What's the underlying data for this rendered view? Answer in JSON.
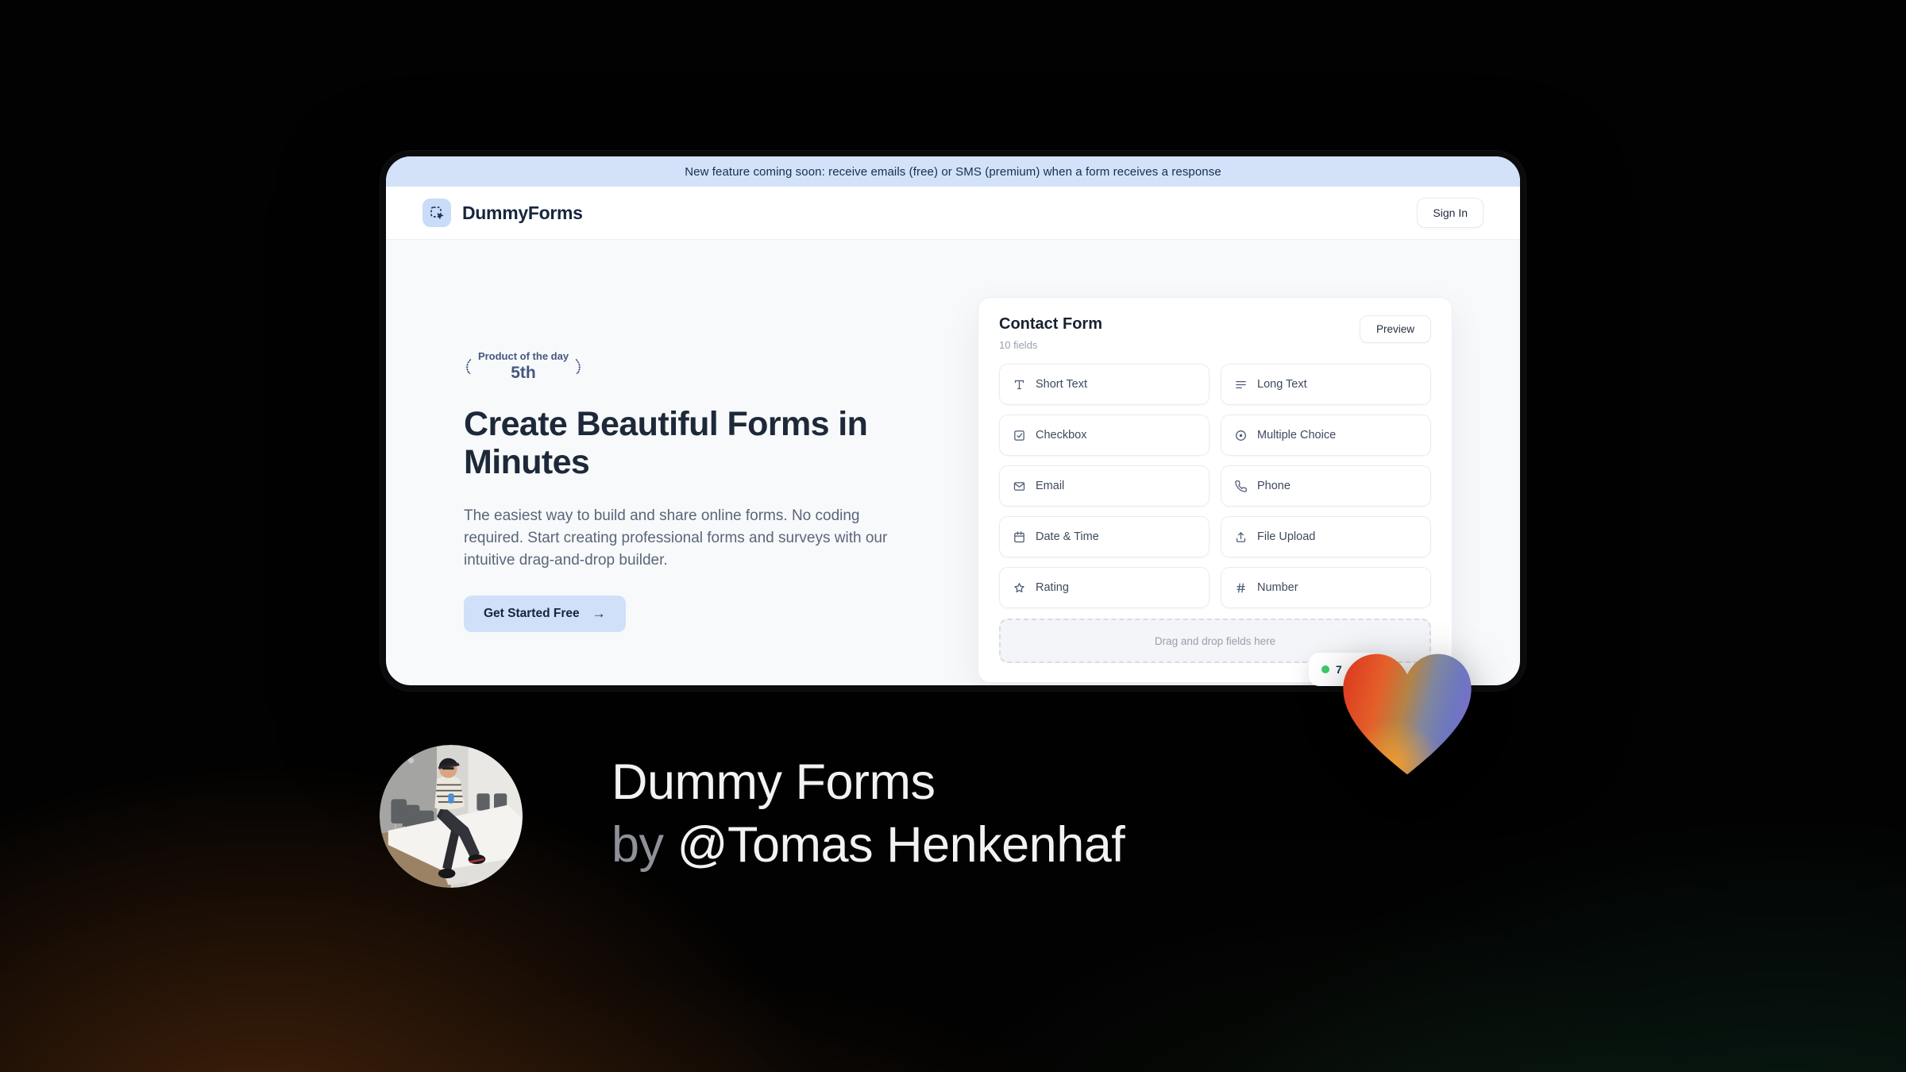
{
  "banner": {
    "text": "New feature coming soon: receive emails (free) or SMS (premium) when a form receives a response"
  },
  "header": {
    "brand": "DummyForms",
    "sign_in_label": "Sign In",
    "logo_icon": "dashed-select-cursor-icon"
  },
  "hero": {
    "award": {
      "line1": "Product of the day",
      "line2": "5th",
      "icon": "laurel-wreath-icon"
    },
    "title": "Create Beautiful Forms in Minutes",
    "description": "The easiest way to build and share online forms. No coding required. Start creating professional forms and surveys with our intuitive drag-and-drop builder.",
    "cta_label": "Get Started Free",
    "cta_arrow": "→"
  },
  "form_builder": {
    "title": "Contact Form",
    "subtitle": "10 fields",
    "preview_label": "Preview",
    "fields": [
      {
        "label": "Short Text",
        "icon": "short-text-icon"
      },
      {
        "label": "Long Text",
        "icon": "long-text-icon"
      },
      {
        "label": "Checkbox",
        "icon": "checkbox-icon"
      },
      {
        "label": "Multiple Choice",
        "icon": "radio-icon"
      },
      {
        "label": "Email",
        "icon": "envelope-icon"
      },
      {
        "label": "Phone",
        "icon": "phone-icon"
      },
      {
        "label": "Date & Time",
        "icon": "calendar-icon"
      },
      {
        "label": "File Upload",
        "icon": "upload-icon"
      },
      {
        "label": "Rating",
        "icon": "star-icon"
      },
      {
        "label": "Number",
        "icon": "hash-icon"
      }
    ],
    "dropzone_text": "Drag and drop fields here",
    "notification_badge": {
      "value": "7",
      "dot_color": "#3fca6b"
    }
  },
  "footer": {
    "title": "Dummy Forms",
    "byline_prefix": "by",
    "author": "@Tomas Henkenhaf"
  },
  "colors": {
    "accent_light_blue": "#cfe0f8",
    "banner_bg": "#d3e2f9",
    "headline_navy": "#1d2939",
    "award_slate": "#47587e",
    "heart_red": "#dd3a1f",
    "heart_orange": "#f49c2c",
    "heart_purple": "#7a6fc8",
    "status_green": "#3fca6b",
    "bg_black": "#020202"
  }
}
